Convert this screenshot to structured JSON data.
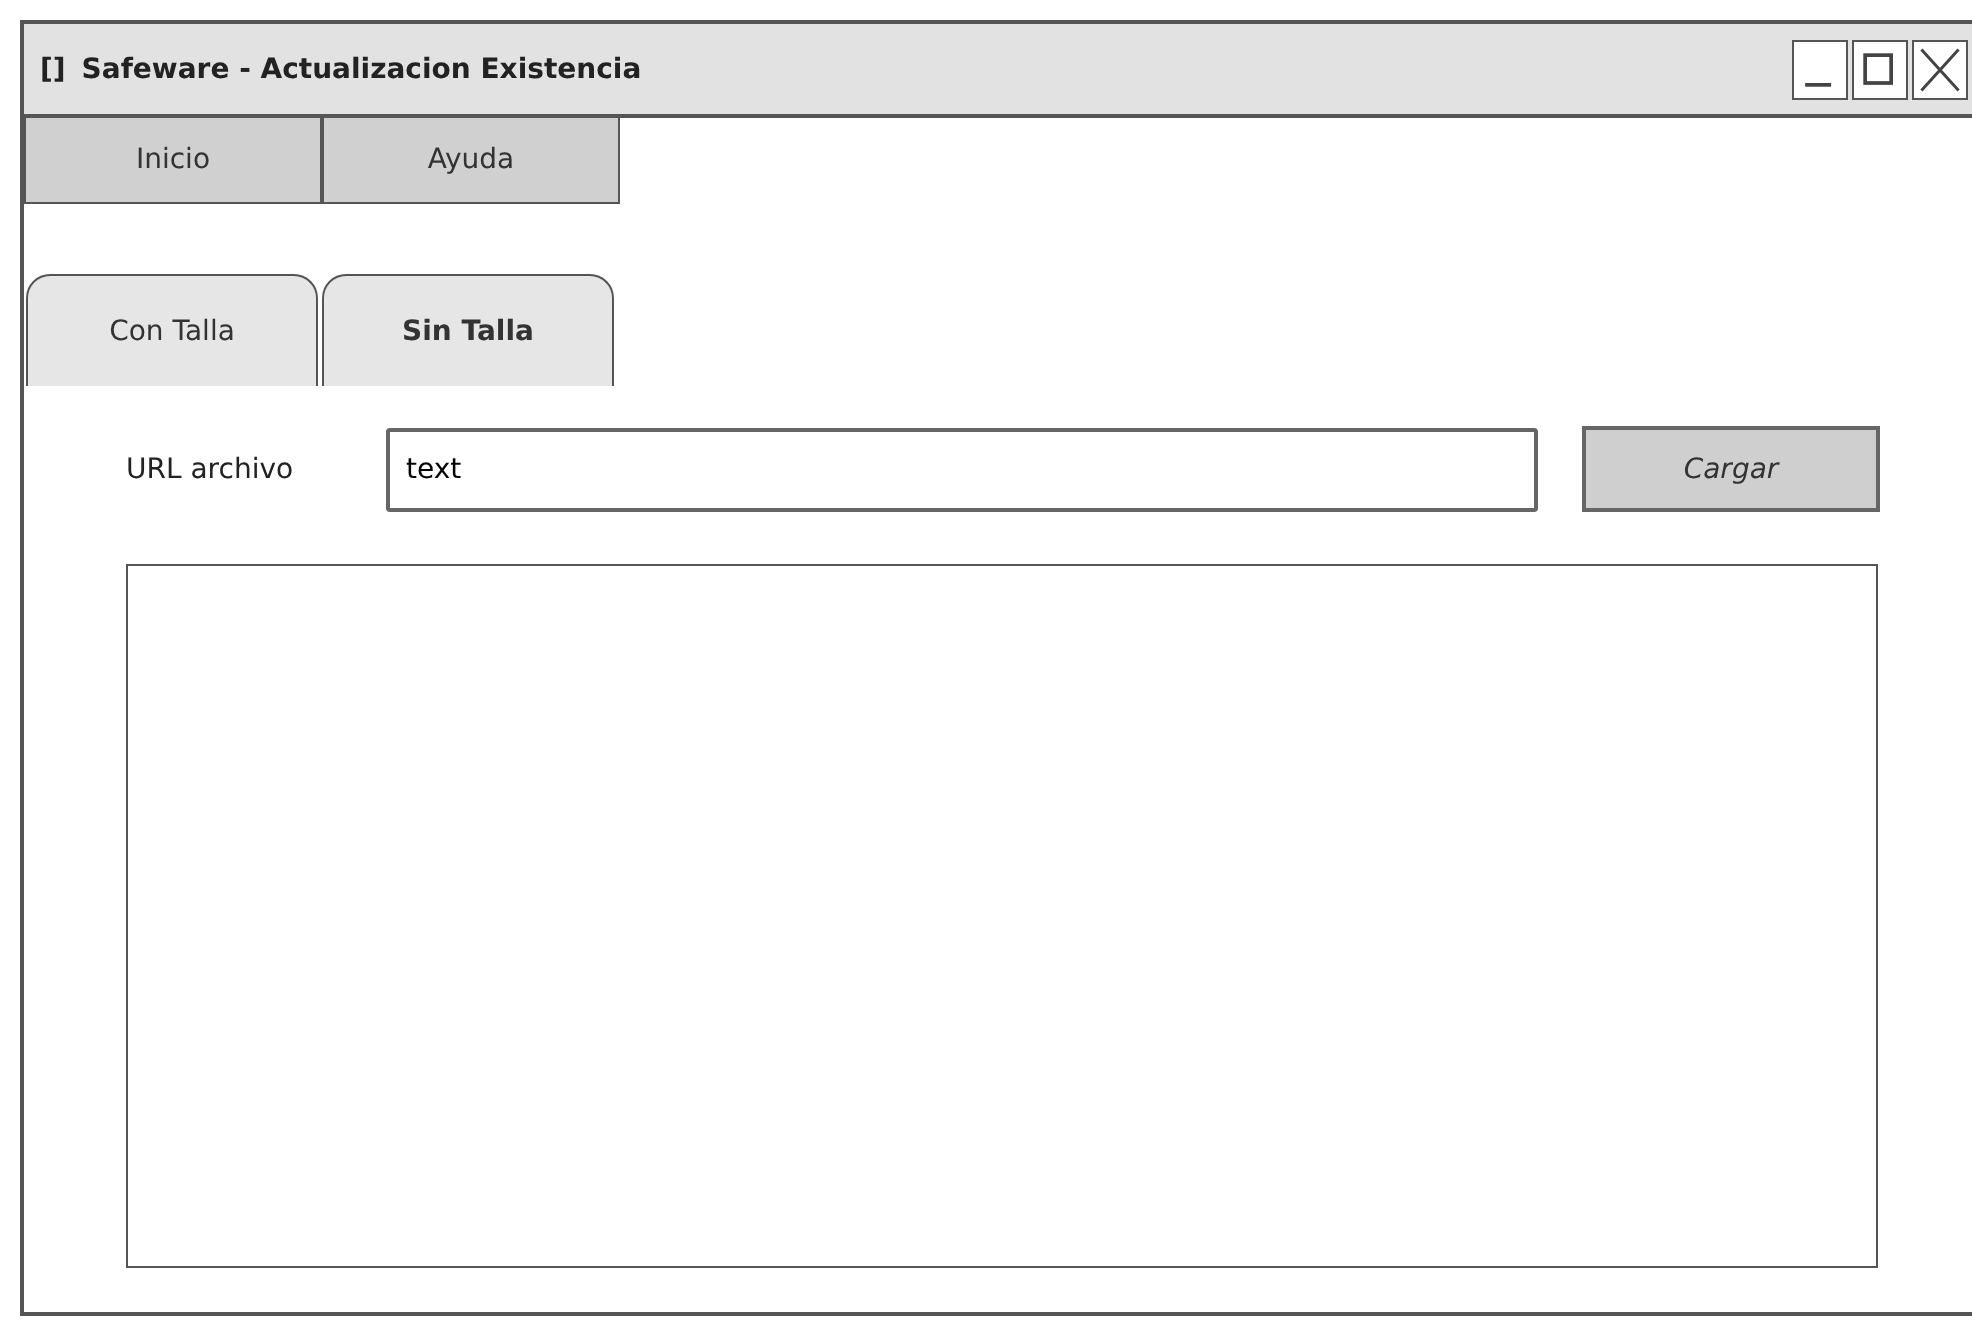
{
  "window": {
    "icon_text": "[]",
    "title": "Safeware - Actualizacion Existencia"
  },
  "menu": [
    {
      "label": "Inicio"
    },
    {
      "label": "Ayuda"
    }
  ],
  "tabs": [
    {
      "label": "Con Talla",
      "selected": false
    },
    {
      "label": "Sin Talla",
      "selected": true
    }
  ],
  "url_field": {
    "label": "URL archivo",
    "value": "text"
  },
  "load_button": {
    "label": "Cargar"
  }
}
